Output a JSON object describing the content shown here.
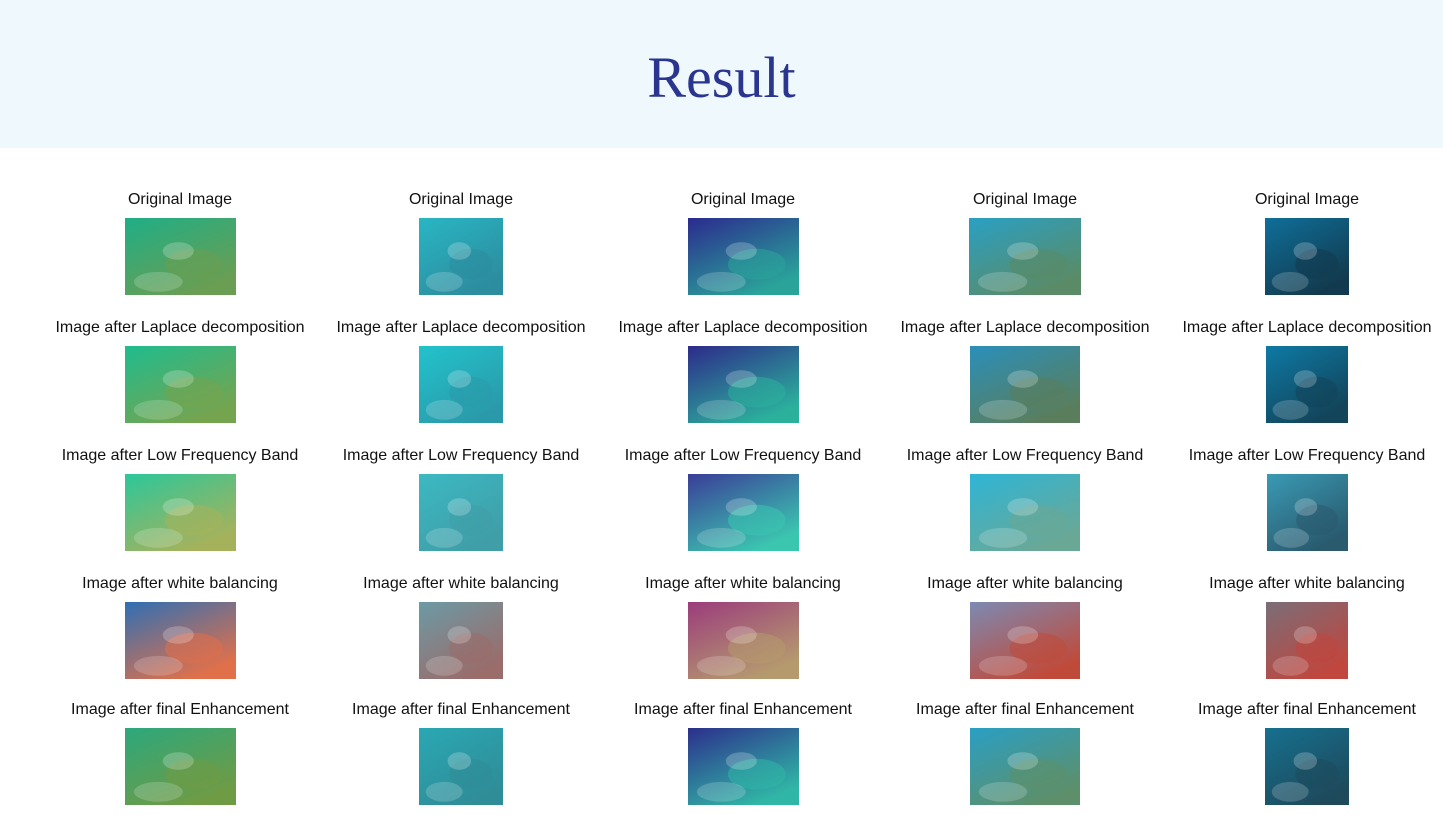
{
  "title": "Result",
  "row_labels": [
    "Original Image",
    "Image after Laplace decomposition",
    "Image after Low Frequency Band",
    "Image after white balancing",
    "Image after final Enhancement"
  ],
  "columns": [
    {
      "name": "reef-scene",
      "colors": [
        [
          "#1fae86",
          "#6a9e52"
        ],
        [
          "#1fbc8e",
          "#75a44f"
        ],
        [
          "#2cc79a",
          "#a6b25b"
        ],
        [
          "#2f6fb4",
          "#e0704a"
        ],
        [
          "#2ca87c",
          "#6f9b45"
        ]
      ]
    },
    {
      "name": "coral-scene",
      "colors": [
        [
          "#29b6c3",
          "#2c8d9f"
        ],
        [
          "#22c3cc",
          "#2a9aaa"
        ],
        [
          "#3cb9c2",
          "#3f9ea8"
        ],
        [
          "#6c9aa5",
          "#9a6c6a"
        ],
        [
          "#2aa8b3",
          "#2f8d98"
        ]
      ]
    },
    {
      "name": "ray-scene",
      "colors": [
        [
          "#2b2a8e",
          "#2aa49a"
        ],
        [
          "#2d2a8a",
          "#2bb09c"
        ],
        [
          "#3a3d98",
          "#3bc6b0"
        ],
        [
          "#9b3c7c",
          "#b59a6e"
        ],
        [
          "#2c2f8c",
          "#30b6a6"
        ]
      ]
    },
    {
      "name": "shark-scene",
      "colors": [
        [
          "#2aa0c4",
          "#5a8b66"
        ],
        [
          "#2a8fba",
          "#5a7e5c"
        ],
        [
          "#2eb5d6",
          "#6aa896"
        ],
        [
          "#7c8ab2",
          "#c04a3a"
        ],
        [
          "#2a9fc4",
          "#5d8f6a"
        ]
      ]
    },
    {
      "name": "diver-scene",
      "colors": [
        [
          "#0f6f9a",
          "#123a4e"
        ],
        [
          "#0e7aa5",
          "#12445a"
        ],
        [
          "#3a9ab4",
          "#295a6e"
        ],
        [
          "#7a6e78",
          "#c0463e"
        ],
        [
          "#16708f",
          "#1e4a5c"
        ]
      ]
    }
  ]
}
